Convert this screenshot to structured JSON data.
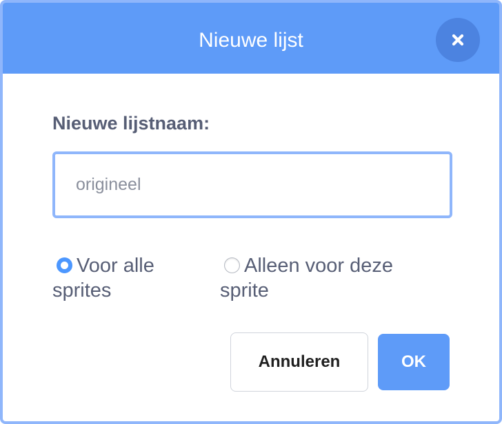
{
  "dialog": {
    "title": "Nieuwe lijst",
    "close_icon": "close-x-icon"
  },
  "form": {
    "name_label": "Nieuwe lijstnaam:",
    "name_input": {
      "value": "",
      "placeholder": "origineel"
    },
    "scope_options": [
      {
        "label": "Voor alle sprites",
        "selected": true
      },
      {
        "label": "Alleen voor deze sprite",
        "selected": false
      }
    ]
  },
  "buttons": {
    "cancel_label": "Annuleren",
    "ok_label": "OK"
  },
  "colors": {
    "header": "#5e9bf8",
    "close_button": "#4c83e0",
    "input_focus_border": "#8fb6fb",
    "radio_selected": "#4c97ff",
    "text": "#575e75",
    "ok_button": "#5e9bf8"
  }
}
